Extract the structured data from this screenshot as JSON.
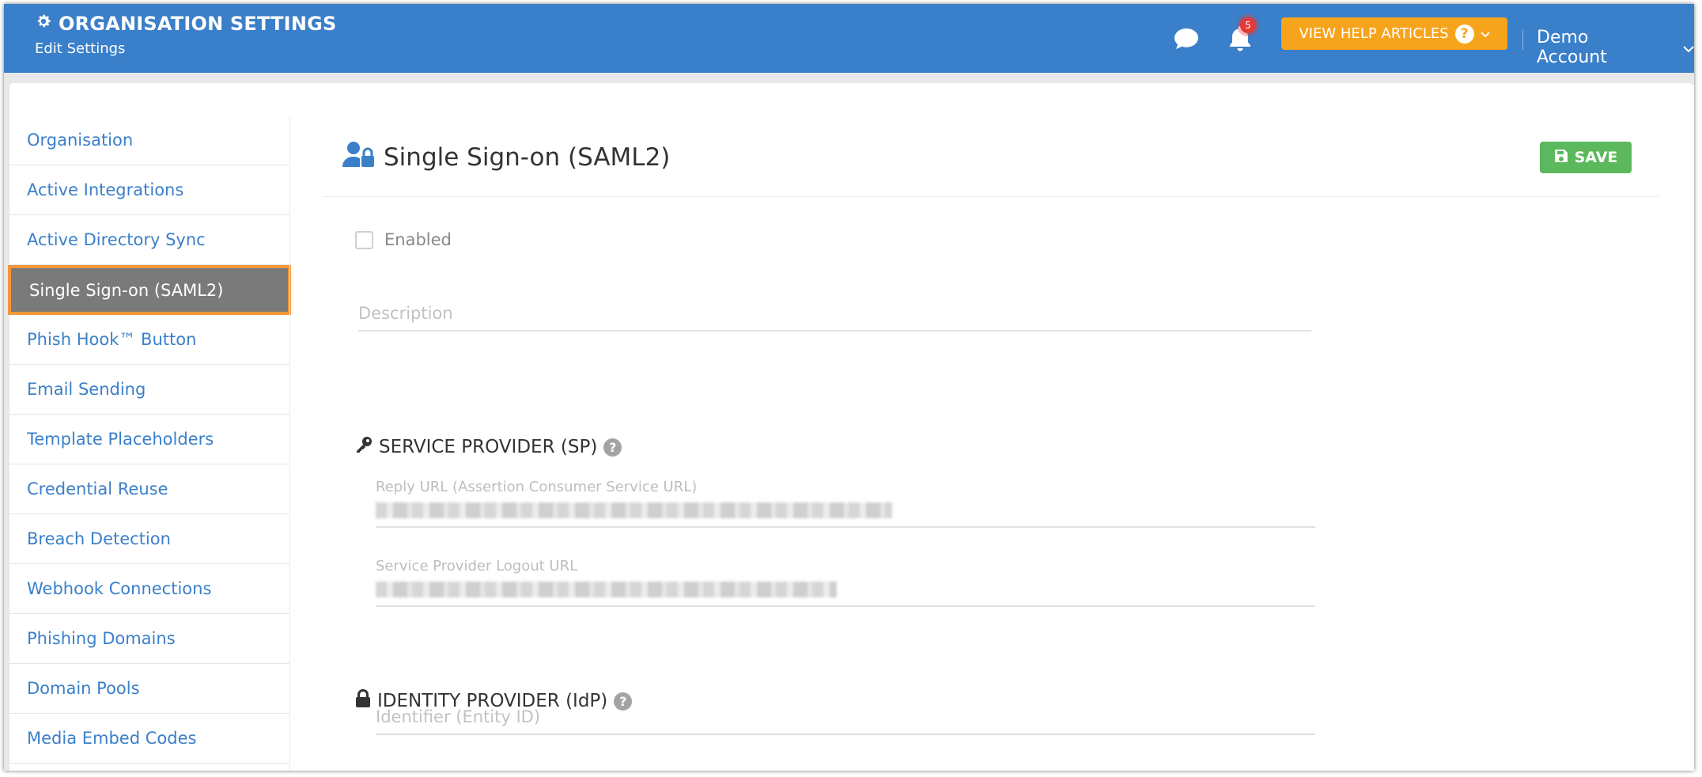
{
  "header": {
    "title": "ORGANISATION SETTINGS",
    "subtitle": "Edit Settings",
    "notification_count": "5",
    "help_button_label": "VIEW HELP ARTICLES",
    "help_button_icon": "?",
    "account_name": "Demo Account"
  },
  "sidebar": {
    "items": [
      {
        "label": "Organisation"
      },
      {
        "label": "Active Integrations"
      },
      {
        "label": "Active Directory Sync"
      },
      {
        "label": "Single Sign-on (SAML2)"
      },
      {
        "label": "Phish Hook™ Button"
      },
      {
        "label": "Email Sending"
      },
      {
        "label": "Template Placeholders"
      },
      {
        "label": "Credential Reuse"
      },
      {
        "label": "Breach Detection"
      },
      {
        "label": "Webhook Connections"
      },
      {
        "label": "Phishing Domains"
      },
      {
        "label": "Domain Pools"
      },
      {
        "label": "Media Embed Codes"
      }
    ],
    "active_index": 3
  },
  "main": {
    "title": "Single Sign-on (SAML2)",
    "save_label": "SAVE",
    "enabled_label": "Enabled",
    "description_placeholder": "Description",
    "sp_section": {
      "title": "SERVICE PROVIDER (SP)",
      "help": "?",
      "reply_url_label": "Reply URL (Assertion Consumer Service URL)",
      "logout_url_label": "Service Provider Logout URL"
    },
    "idp_section": {
      "title": "IDENTITY PROVIDER (IdP)",
      "help": "?",
      "identifier_placeholder": "Identifier (Entity ID)"
    }
  },
  "colors": {
    "header_blue": "#3a7fca",
    "help_orange": "#f7a41d",
    "save_green": "#5cb85c",
    "active_bg": "#7a7a7a",
    "active_outline": "#f2963a",
    "badge_red": "#e53935"
  }
}
